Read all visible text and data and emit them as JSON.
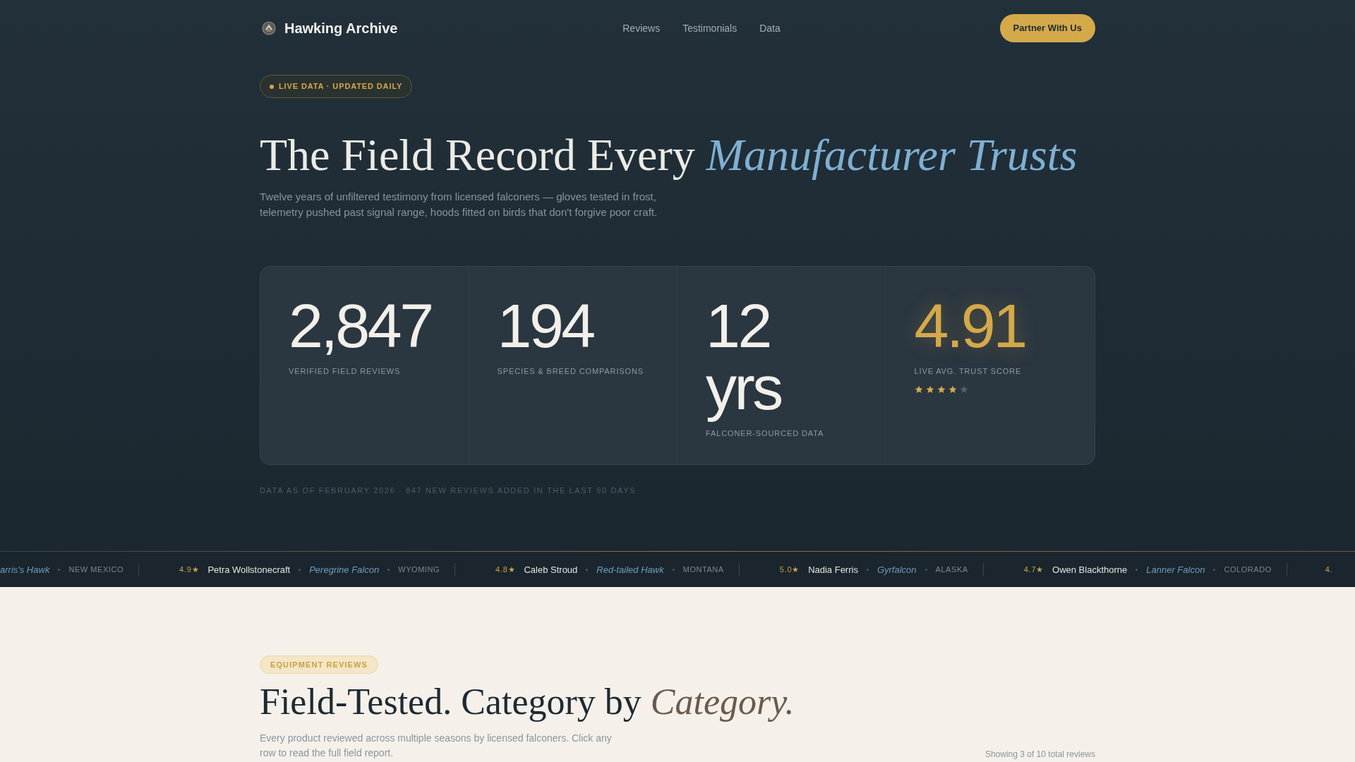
{
  "nav": {
    "brand": "Hawking Archive",
    "links": [
      {
        "label": "Reviews"
      },
      {
        "label": "Testimonials"
      },
      {
        "label": "Data"
      }
    ],
    "cta": "Partner With Us"
  },
  "hero": {
    "badge": "LIVE DATA · UPDATED DAILY",
    "headline": "The Field Record Every *Manufacturer Trusts*",
    "subtitle": "Twelve years of unfiltered testimony from licensed falconers — gloves tested in frost, telemetry pushed past signal range, hoods fitted on birds that don't forgive poor craft.",
    "stats": [
      {
        "kind": "plain",
        "value": "2,847",
        "label": "VERIFIED FIELD REVIEWS"
      },
      {
        "kind": "plain",
        "value": "194",
        "label": "SPECIES & BREED COMPARISONS"
      },
      {
        "kind": "plain",
        "value": "12 yrs",
        "label": "FALCONER-SOURCED DATA"
      },
      {
        "kind": "score",
        "value": "4.91",
        "label": "LIVE AVG. TRUST SCORE",
        "stars": 4
      }
    ],
    "footnote": "DATA AS OF FEBRUARY 2026 · 847 NEW REVIEWS ADDED IN THE LAST 90 DAYS"
  },
  "ticker": [
    {
      "species": "arris's Hawk",
      "region": "NEW MEXICO"
    },
    {
      "rating": "4.9★",
      "name": "Petra Wollstonecraft",
      "species": "Peregrine Falcon",
      "region": "WYOMING"
    },
    {
      "rating": "4.8★",
      "name": "Caleb Stroud",
      "species": "Red-tailed Hawk",
      "region": "MONTANA"
    },
    {
      "rating": "5.0★",
      "name": "Nadia Ferris",
      "species": "Gyrfalcon",
      "region": "ALASKA"
    },
    {
      "rating": "4.7★",
      "name": "Owen Blackthorne",
      "species": "Lanner Falcon",
      "region": "COLORADO"
    },
    {
      "rating": "4."
    }
  ],
  "equipment_section": {
    "badge": "EQUIPMENT REVIEWS",
    "heading": "Field-Tested. Category by *Category.*",
    "description": "Every product reviewed across multiple seasons by licensed falconers. Click any row to read the full field report.",
    "count": "Showing 3 of 10 total reviews"
  }
}
